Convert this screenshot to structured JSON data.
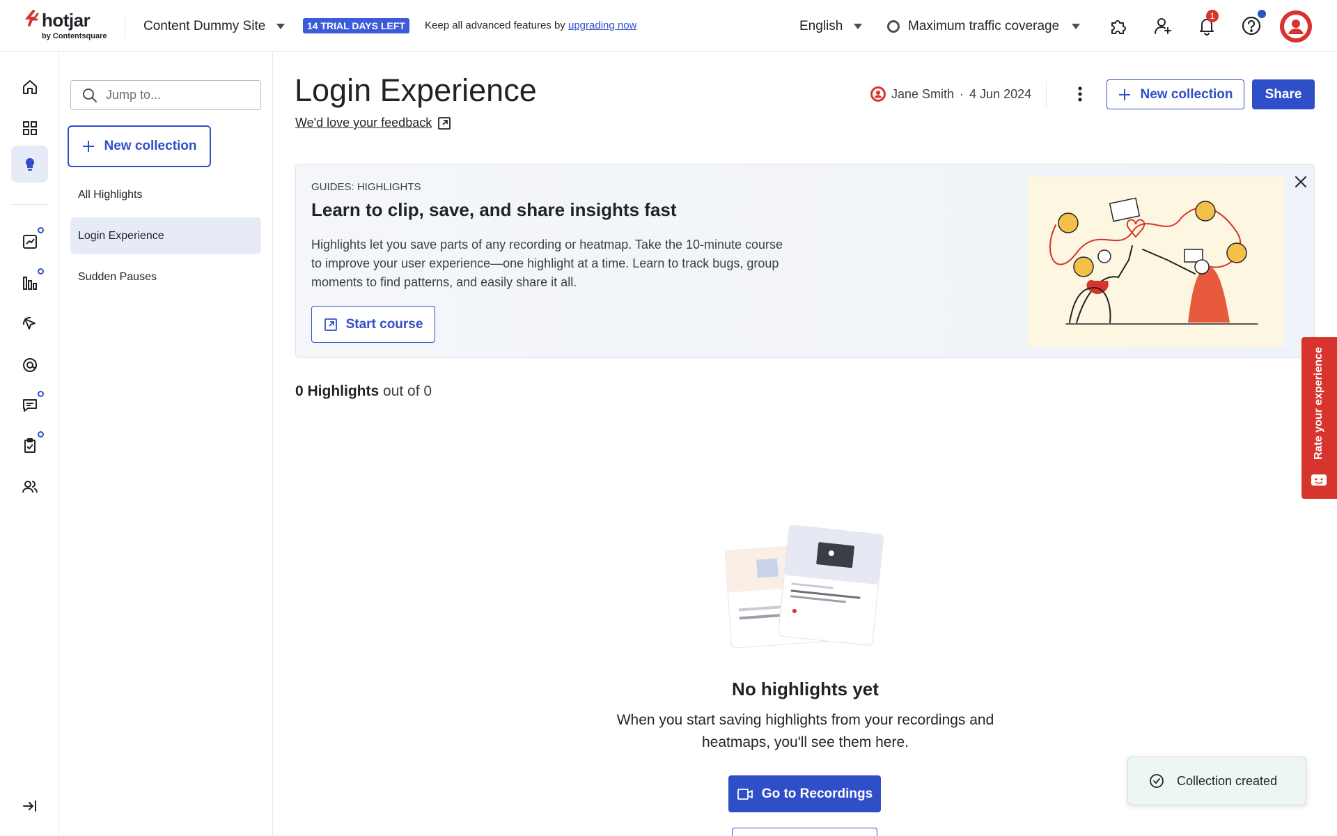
{
  "header": {
    "logo_word": "hotjar",
    "logo_by": "by Contentsquare",
    "site_name": "Content Dummy Site",
    "trial_badge": "14 TRIAL DAYS LEFT",
    "trial_text": "Keep all advanced features by ",
    "trial_link": "upgrading now",
    "language": "English",
    "traffic": "Maximum traffic coverage",
    "notification_count": "1"
  },
  "sidebar": {
    "search_placeholder": "Jump to...",
    "new_collection_label": "New collection",
    "items": [
      {
        "label": "All Highlights",
        "active": false
      },
      {
        "label": "Login Experience",
        "active": true
      },
      {
        "label": "Sudden Pauses",
        "active": false
      }
    ]
  },
  "main": {
    "title": "Login Experience",
    "feedback_link": "We'd love your feedback",
    "owner_name": "Jane Smith",
    "owner_separator": "·",
    "owner_date": "4 Jun 2024",
    "new_collection_label": "New collection",
    "share_label": "Share",
    "guide": {
      "kicker": "GUIDES: HIGHLIGHTS",
      "title": "Learn to clip, save, and share insights fast",
      "description": "Highlights let you save parts of any recording or heatmap. Take the 10-minute course to improve your user experience—one highlight at a time. Learn to track bugs, group moments to find patterns, and easily share it all.",
      "cta": "Start course"
    },
    "count_number": "0 Highlights",
    "count_suffix": " out of 0",
    "empty": {
      "title": "No highlights yet",
      "description": "When you start saving highlights from your recordings and heatmaps, you'll see them here.",
      "cta": "Go to Recordings"
    }
  },
  "rate_tab": "Rate your experience",
  "toast": "Collection created",
  "colors": {
    "brand_blue": "#2f4fc9",
    "brand_red": "#d6342c",
    "active_bg": "#e7ebf7"
  }
}
